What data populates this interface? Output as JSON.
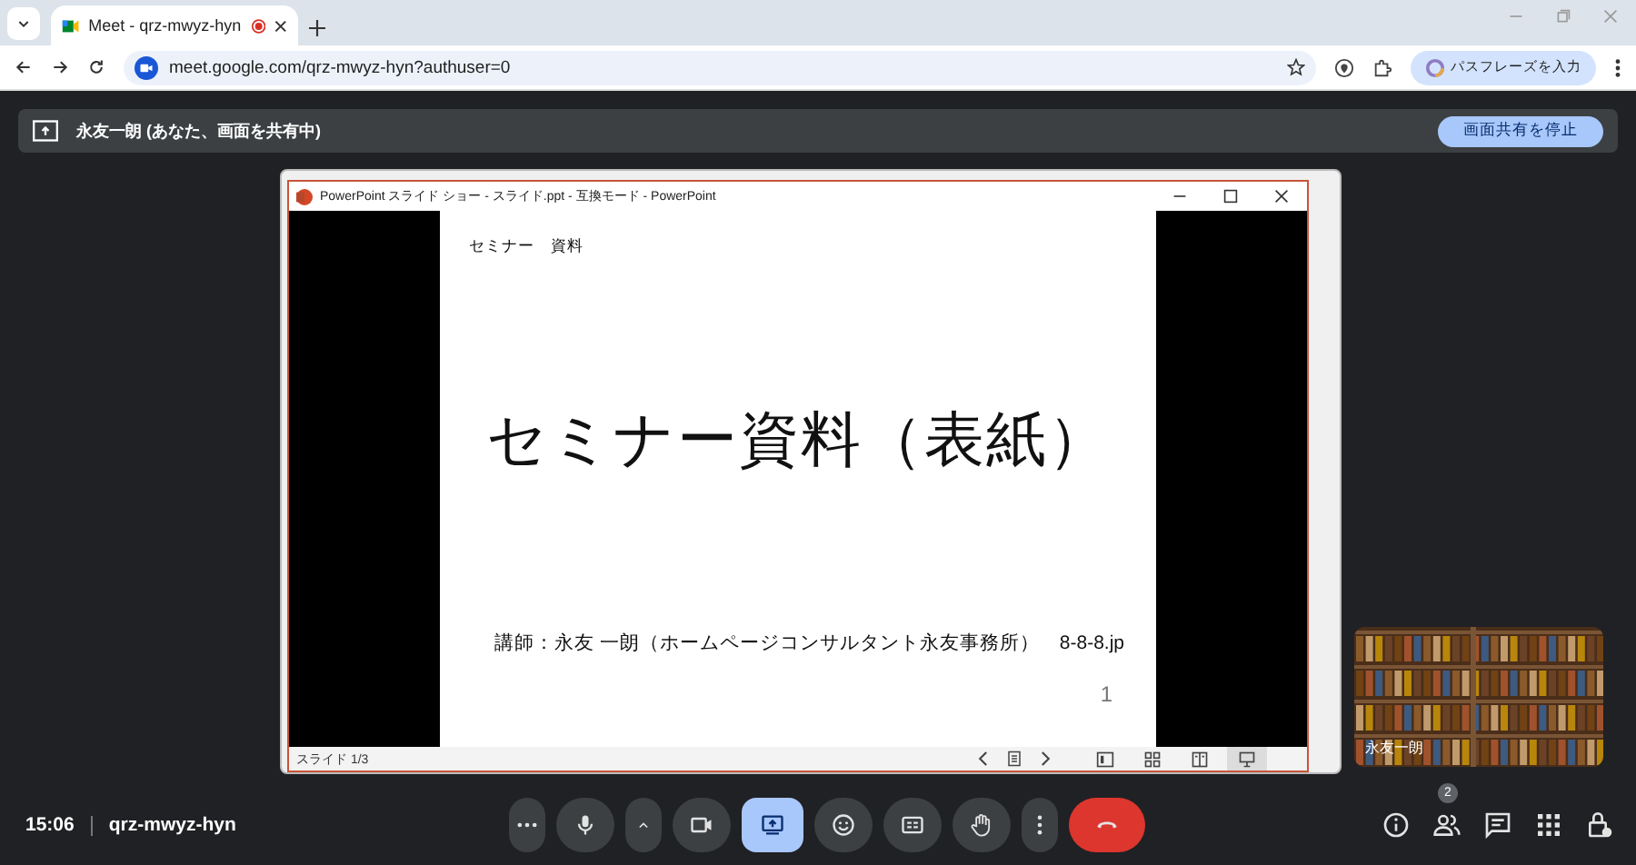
{
  "browser": {
    "tab_title": "Meet - qrz-mwyz-hyn",
    "url": "meet.google.com/qrz-mwyz-hyn?authuser=0",
    "passphrase_button": "パスフレーズを入力"
  },
  "share_banner": {
    "text": "永友一朗 (あなた、画面を共有中)",
    "stop_button": "画面共有を停止"
  },
  "powerpoint_window": {
    "title": "PowerPoint スライド ショー - スライド.ppt - 互換モード - PowerPoint",
    "slide": {
      "header": "セミナー　資料",
      "title": "セミナー資料（表紙）",
      "footer": "講師：永友 一朗（ホームページコンサルタント永友事務所）　8-8-8.jp",
      "page_number": "1"
    },
    "status": "スライド 1/3",
    "views": [
      {
        "kind": "normal",
        "selected": false
      },
      {
        "kind": "sorter",
        "selected": false
      },
      {
        "kind": "reading",
        "selected": false
      },
      {
        "kind": "slideshow",
        "selected": true
      }
    ]
  },
  "self_view": {
    "name": "永友一朗"
  },
  "bottom_bar": {
    "time": "15:06",
    "meeting_code": "qrz-mwyz-hyn",
    "controls": [
      {
        "kind": "more",
        "active": false
      },
      {
        "kind": "mic",
        "active": false
      },
      {
        "kind": "caret",
        "active": false
      },
      {
        "kind": "camera",
        "active": false
      },
      {
        "kind": "present",
        "active": true
      },
      {
        "kind": "emoji",
        "active": false
      },
      {
        "kind": "captions",
        "active": false
      },
      {
        "kind": "hand",
        "active": false
      },
      {
        "kind": "more-vert",
        "active": false
      },
      {
        "kind": "hangup",
        "active": false
      }
    ],
    "side_buttons": [
      {
        "kind": "info"
      },
      {
        "kind": "people",
        "badge": "2"
      },
      {
        "kind": "chat"
      },
      {
        "kind": "apps"
      },
      {
        "kind": "lock"
      }
    ]
  }
}
